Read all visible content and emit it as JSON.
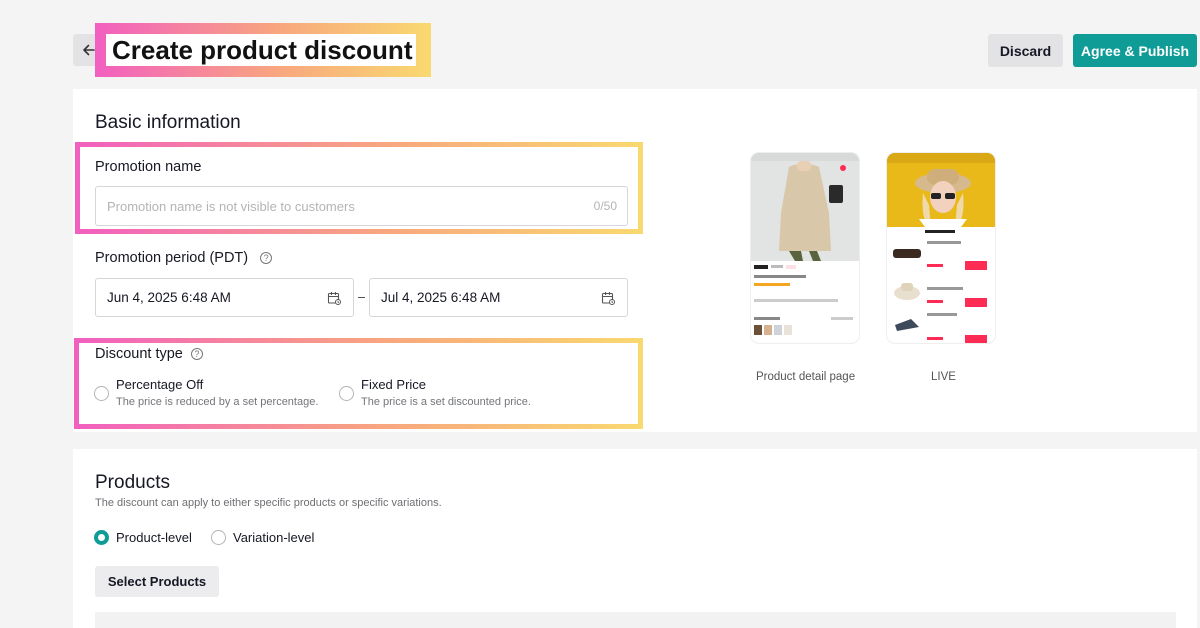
{
  "header": {
    "title": "Create product discount",
    "discard_label": "Discard",
    "publish_label": "Agree & Publish"
  },
  "basic": {
    "section_title": "Basic information",
    "promotion_name": {
      "label": "Promotion name",
      "placeholder": "Promotion name is not visible to customers",
      "counter": "0/50",
      "value": ""
    },
    "promotion_period": {
      "label": "Promotion period (PDT)",
      "help": "?",
      "start": "Jun 4, 2025 6:48 AM",
      "end": "Jul 4, 2025 6:48 AM"
    },
    "discount_type": {
      "label": "Discount type",
      "help": "?",
      "options": [
        {
          "title": "Percentage Off",
          "desc": "The price is reduced by a set percentage.",
          "checked": false
        },
        {
          "title": "Fixed Price",
          "desc": "The price is a set discounted price.",
          "checked": false
        }
      ]
    },
    "previews": [
      {
        "caption": "Product detail page"
      },
      {
        "caption": "LIVE"
      }
    ]
  },
  "products": {
    "section_title": "Products",
    "description": "The discount can apply to either specific products or specific variations.",
    "levels": [
      {
        "label": "Product-level",
        "checked": true
      },
      {
        "label": "Variation-level",
        "checked": false
      }
    ],
    "select_label": "Select Products"
  },
  "colors": {
    "accent": "#0f9c97",
    "highlight_start": "#f25fc0",
    "highlight_end": "#f9d970"
  }
}
